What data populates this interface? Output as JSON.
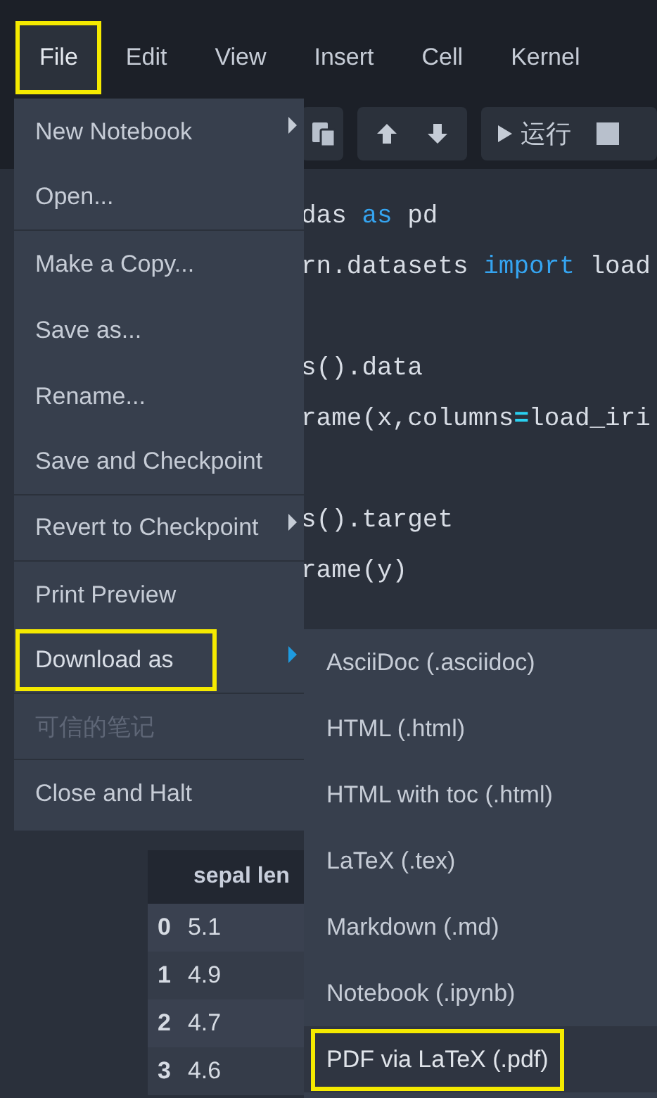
{
  "menubar": [
    {
      "label": "File",
      "selected": true,
      "outlined": true
    },
    {
      "label": "Edit",
      "selected": false,
      "outlined": false
    },
    {
      "label": "View",
      "selected": false,
      "outlined": false
    },
    {
      "label": "Insert",
      "selected": false,
      "outlined": false
    },
    {
      "label": "Cell",
      "selected": false,
      "outlined": false
    },
    {
      "label": "Kernel",
      "selected": false,
      "outlined": false
    }
  ],
  "toolbar": {
    "run_label": "运行"
  },
  "code_lines": [
    {
      "kind": "code",
      "tokens": [
        {
          "text": "das ",
          "kind": "plain"
        },
        {
          "text": "as",
          "kind": "keyword"
        },
        {
          "text": " pd",
          "kind": "plain"
        }
      ]
    },
    {
      "kind": "code",
      "tokens": [
        {
          "text": "rn.datasets ",
          "kind": "plain"
        },
        {
          "text": "import",
          "kind": "keyword"
        },
        {
          "text": " load",
          "kind": "plain"
        }
      ]
    },
    {
      "kind": "blank"
    },
    {
      "kind": "code",
      "tokens": [
        {
          "text": "s().data",
          "kind": "plain"
        }
      ]
    },
    {
      "kind": "code",
      "tokens": [
        {
          "text": "rame(x,columns",
          "kind": "plain"
        },
        {
          "text": "=",
          "kind": "operator"
        },
        {
          "text": "load_iri",
          "kind": "plain"
        }
      ]
    },
    {
      "kind": "blank"
    },
    {
      "kind": "code",
      "tokens": [
        {
          "text": "s().target",
          "kind": "plain"
        }
      ]
    },
    {
      "kind": "code",
      "tokens": [
        {
          "text": "rame(y)",
          "kind": "plain"
        }
      ]
    }
  ],
  "output_table": {
    "columns": [
      "sepal len"
    ],
    "rows": [
      {
        "index": "0",
        "values": [
          "5.1"
        ]
      },
      {
        "index": "1",
        "values": [
          "4.9"
        ]
      },
      {
        "index": "2",
        "values": [
          "4.7"
        ]
      },
      {
        "index": "3",
        "values": [
          "4.6"
        ]
      }
    ]
  },
  "file_menu": [
    {
      "label": "New Notebook",
      "submenu": true,
      "selected": false,
      "disabled": false,
      "outlined": false,
      "divider_after": false
    },
    {
      "label": "Open...",
      "submenu": false,
      "selected": false,
      "disabled": false,
      "outlined": false,
      "divider_after": true
    },
    {
      "label": "Make a Copy...",
      "submenu": false,
      "selected": false,
      "disabled": false,
      "outlined": false,
      "divider_after": false
    },
    {
      "label": "Save as...",
      "submenu": false,
      "selected": false,
      "disabled": false,
      "outlined": false,
      "divider_after": false
    },
    {
      "label": "Rename...",
      "submenu": false,
      "selected": false,
      "disabled": false,
      "outlined": false,
      "divider_after": false
    },
    {
      "label": "Save and Checkpoint",
      "submenu": false,
      "selected": false,
      "disabled": false,
      "outlined": false,
      "divider_after": true
    },
    {
      "label": "Revert to Checkpoint",
      "submenu": true,
      "selected": false,
      "disabled": false,
      "outlined": false,
      "divider_after": true
    },
    {
      "label": "Print Preview",
      "submenu": false,
      "selected": false,
      "disabled": false,
      "outlined": false,
      "divider_after": false
    },
    {
      "label": "Download as",
      "submenu": true,
      "selected": true,
      "disabled": false,
      "outlined": true,
      "divider_after": true
    },
    {
      "label": "可信的笔记",
      "submenu": false,
      "selected": false,
      "disabled": true,
      "outlined": false,
      "divider_after": true
    },
    {
      "label": "Close and Halt",
      "submenu": false,
      "selected": false,
      "disabled": false,
      "outlined": false,
      "divider_after": false
    }
  ],
  "download_submenu": [
    {
      "label": "AsciiDoc (.asciidoc)",
      "selected": false,
      "outlined": false
    },
    {
      "label": "HTML (.html)",
      "selected": false,
      "outlined": false
    },
    {
      "label": "HTML with toc (.html)",
      "selected": false,
      "outlined": false
    },
    {
      "label": "LaTeX (.tex)",
      "selected": false,
      "outlined": false
    },
    {
      "label": "Markdown (.md)",
      "selected": false,
      "outlined": false
    },
    {
      "label": "Notebook (.ipynb)",
      "selected": false,
      "outlined": false
    },
    {
      "label": "PDF via LaTeX (.pdf)",
      "selected": true,
      "outlined": true
    }
  ]
}
